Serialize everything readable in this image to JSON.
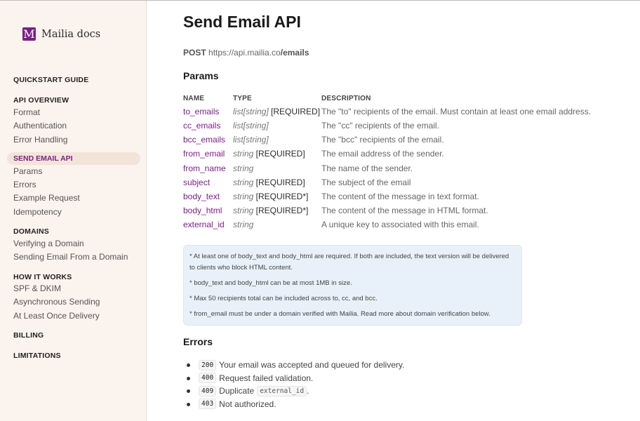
{
  "brand": {
    "logo_letter": "M",
    "name": "Mailia docs"
  },
  "sidebar": {
    "sections": [
      {
        "label": "QUICKSTART GUIDE",
        "items": []
      },
      {
        "label": "API OVERVIEW",
        "items": [
          "Format",
          "Authentication",
          "Error Handling"
        ]
      },
      {
        "label": "SEND EMAIL API",
        "active": true,
        "items": [
          "Params",
          "Errors",
          "Example Request",
          "Idempotency"
        ]
      },
      {
        "label": "DOMAINS",
        "items": [
          "Verifying a Domain",
          "Sending Email From a Domain"
        ]
      },
      {
        "label": "HOW IT WORKS",
        "items": [
          "SPF & DKIM",
          "Asynchronous Sending",
          "At Least Once Delivery"
        ]
      },
      {
        "label": "BILLING",
        "items": []
      },
      {
        "label": "LIMITATIONS",
        "items": []
      }
    ]
  },
  "main": {
    "title": "Send Email API",
    "endpoint": {
      "method": "POST",
      "base": "https://api.mailia.co",
      "path": "/emails"
    },
    "params_heading": "Params",
    "params_columns": [
      "NAME",
      "TYPE",
      "DESCRIPTION"
    ],
    "params": [
      {
        "name": "to_emails",
        "type": "list[string]",
        "req": " [REQUIRED]",
        "desc": "The \"to\" recipients of the email. Must contain at least one email address."
      },
      {
        "name": "cc_emails",
        "type": "list[string]",
        "req": "",
        "desc": "The \"cc\" recipients of the email."
      },
      {
        "name": "bcc_emails",
        "type": "list[string]",
        "req": "",
        "desc": "The \"bcc\" recipients of the email."
      },
      {
        "name": "from_email",
        "type": "string",
        "req": " [REQUIRED]",
        "desc": "The email address of the sender."
      },
      {
        "name": "from_name",
        "type": "string",
        "req": "",
        "desc": "The name of the sender."
      },
      {
        "name": "subject",
        "type": "string",
        "req": " [REQUIRED]",
        "desc": "The subject of the email"
      },
      {
        "name": "body_text",
        "type": "string",
        "req": " [REQUIRED*]",
        "desc": "The content of the message in text format."
      },
      {
        "name": "body_html",
        "type": "string",
        "req": " [REQUIRED*]",
        "desc": "The content of the message in HTML format."
      },
      {
        "name": "external_id",
        "type": "string",
        "req": "",
        "desc": "A unique key to associated with this email."
      }
    ],
    "notes": [
      "* At least one of body_text and body_html are required. If both are included, the text version will be delivered to clients who block HTML content.",
      "* body_text and body_html can be at most 1MB in size.",
      "* Max 50 recipients total can be included across to, cc, and bcc.",
      "* from_email must be under a domain verified with Mailia. Read more about domain verification below."
    ],
    "errors_heading": "Errors",
    "errors": [
      {
        "code": "200",
        "text": "Your email was accepted and queued for delivery.",
        "inline_code": "",
        "suffix": ""
      },
      {
        "code": "400",
        "text": "Request failed validation.",
        "inline_code": "",
        "suffix": ""
      },
      {
        "code": "409",
        "text": "Duplicate",
        "inline_code": "external_id",
        "suffix": "."
      },
      {
        "code": "403",
        "text": "Not authorized.",
        "inline_code": "",
        "suffix": ""
      }
    ]
  }
}
